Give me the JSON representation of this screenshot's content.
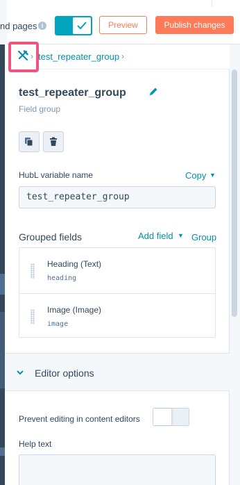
{
  "header": {
    "pages_label": "nd pages",
    "preview_label": "Preview",
    "publish_label": "Publish changes",
    "toggle_state": "on"
  },
  "breadcrumb": {
    "current": "test_repeater_group"
  },
  "field_group": {
    "title": "test_repeater_group",
    "subtitle": "Field group"
  },
  "hubl": {
    "label": "HubL variable name",
    "copy_label": "Copy",
    "value": "test_repeater_group"
  },
  "grouped_fields": {
    "label": "Grouped fields",
    "add_field_label": "Add field",
    "group_label": "Group",
    "items": [
      {
        "name": "Heading (Text)",
        "var": "heading"
      },
      {
        "name": "Image (Image)",
        "var": "image"
      }
    ]
  },
  "editor_options": {
    "label": "Editor options",
    "prevent_label": "Prevent editing in content editors",
    "prevent_state": "off",
    "help_text_label": "Help text"
  },
  "colors": {
    "accent": "#00a4bd",
    "link": "#0091ae",
    "cta": "#ff7a59",
    "highlight": "#f2547d"
  },
  "icons": [
    "info-icon",
    "check-icon",
    "tools-icon",
    "chevron-right-icon",
    "pencil-icon",
    "clone-icon",
    "trash-icon",
    "caret-down-icon",
    "drag-handle-icon",
    "chevron-down-icon"
  ]
}
